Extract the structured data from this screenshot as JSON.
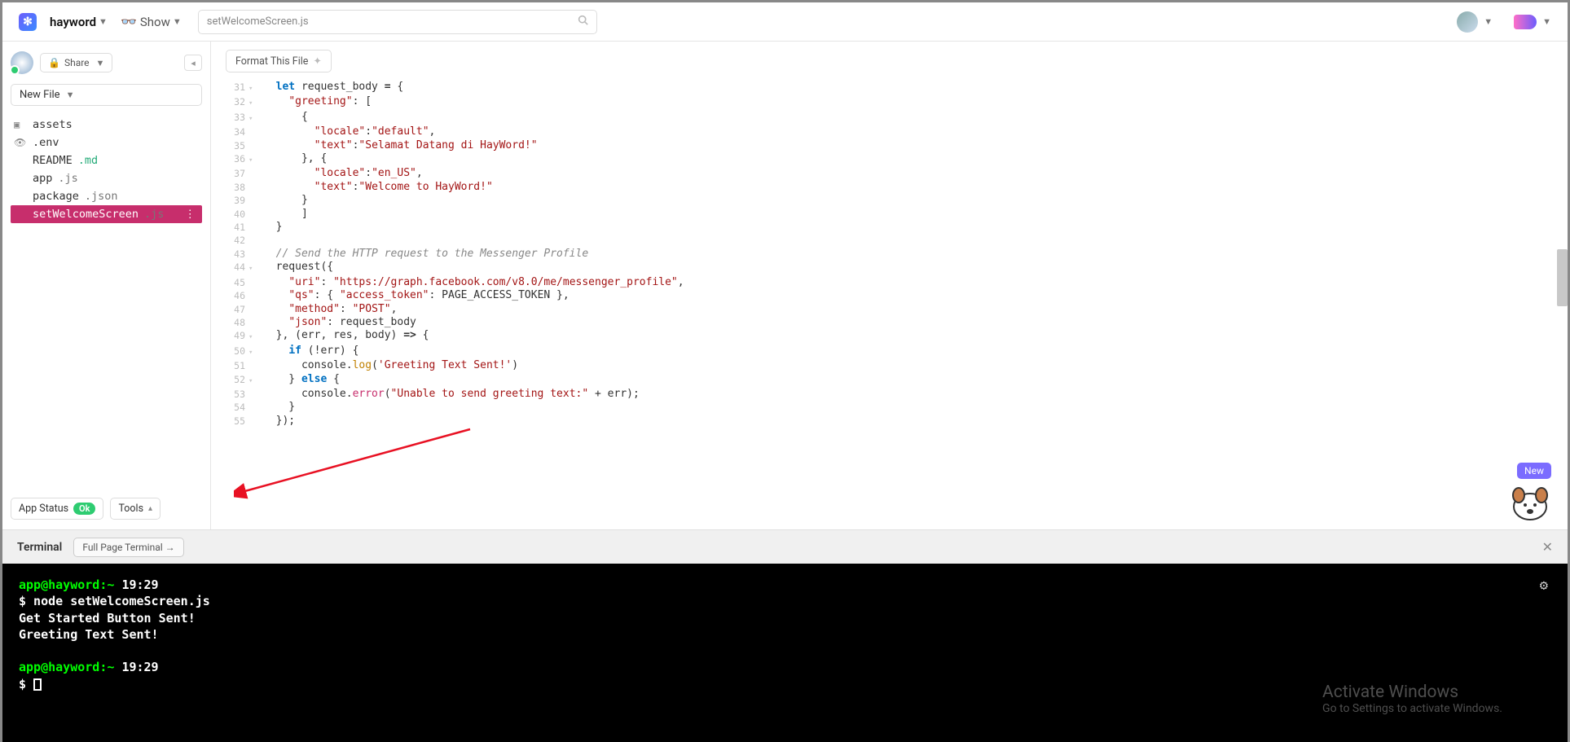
{
  "topbar": {
    "project": "hayword",
    "show_label": "Show",
    "search_value": "setWelcomeScreen.js"
  },
  "sidebar": {
    "share_label": "Share",
    "newfile_label": "New File",
    "files": [
      {
        "name": "assets",
        "icon": "folder"
      },
      {
        "name": ".env",
        "icon": "eye"
      },
      {
        "name": "README",
        "ext": ".md"
      },
      {
        "name": "app",
        "ext": ".js"
      },
      {
        "name": "package",
        "ext": ".json"
      },
      {
        "name": "setWelcomeScreen",
        "ext": ".js",
        "active": true
      }
    ],
    "app_status_label": "App Status",
    "app_status_value": "Ok",
    "tools_label": "Tools"
  },
  "editor": {
    "format_btn": "Format This File"
  },
  "code_lines": [
    {
      "n": 31,
      "f": "v",
      "html": "  <span class='kw'>let</span> request_body <span class='op'>=</span> {"
    },
    {
      "n": 32,
      "f": "v",
      "html": "    <span class='str'>\"greeting\"</span>: ["
    },
    {
      "n": 33,
      "f": "v",
      "html": "      {"
    },
    {
      "n": 34,
      "f": "",
      "html": "        <span class='str'>\"locale\"</span>:<span class='str'>\"default\"</span>,"
    },
    {
      "n": 35,
      "f": "",
      "html": "        <span class='str'>\"text\"</span>:<span class='str'>\"Selamat Datang di HayWord!\"</span>"
    },
    {
      "n": 36,
      "f": "v",
      "html": "      }, {"
    },
    {
      "n": 37,
      "f": "",
      "html": "        <span class='str'>\"locale\"</span>:<span class='str'>\"en_US\"</span>,"
    },
    {
      "n": 38,
      "f": "",
      "html": "        <span class='str'>\"text\"</span>:<span class='str'>\"Welcome to HayWord!\"</span>"
    },
    {
      "n": 39,
      "f": "",
      "html": "      }"
    },
    {
      "n": 40,
      "f": "",
      "html": "      ]"
    },
    {
      "n": 41,
      "f": "",
      "html": "  }"
    },
    {
      "n": 42,
      "f": "",
      "html": ""
    },
    {
      "n": 43,
      "f": "",
      "html": "  <span class='cm'>// Send the HTTP request to the Messenger Profile</span>"
    },
    {
      "n": 44,
      "f": "v",
      "html": "  request({"
    },
    {
      "n": 45,
      "f": "",
      "html": "    <span class='str'>\"uri\"</span>: <span class='str'>\"https://graph.facebook.com/v8.0/me/messenger_profile\"</span>,"
    },
    {
      "n": 46,
      "f": "",
      "html": "    <span class='str'>\"qs\"</span>: { <span class='str'>\"access_token\"</span>: PAGE_ACCESS_TOKEN },"
    },
    {
      "n": 47,
      "f": "",
      "html": "    <span class='str'>\"method\"</span>: <span class='str'>\"POST\"</span>,"
    },
    {
      "n": 48,
      "f": "",
      "html": "    <span class='str'>\"json\"</span>: request_body"
    },
    {
      "n": 49,
      "f": "v",
      "html": "  }, (err, res, body) <span class='op'>=&gt;</span> {"
    },
    {
      "n": 50,
      "f": "v",
      "html": "    <span class='kw'>if</span> (!err) {"
    },
    {
      "n": 51,
      "f": "",
      "html": "      console.<span class='fn'>log</span>(<span class='str'>'Greeting Text Sent!'</span>)"
    },
    {
      "n": 52,
      "f": "v",
      "html": "    } <span class='kw'>else</span> {"
    },
    {
      "n": 53,
      "f": "",
      "html": "      console.<span class='err'>error</span>(<span class='str'>\"Unable to send greeting text:\"</span> + err);"
    },
    {
      "n": 54,
      "f": "",
      "html": "    }"
    },
    {
      "n": 55,
      "f": "",
      "html": "  });"
    }
  ],
  "mascot": {
    "new_label": "New"
  },
  "terminal": {
    "title": "Terminal",
    "fullpage_label": "Full Page Terminal   →",
    "lines": [
      {
        "prompt": "app@hayword:~",
        "time": "19:29"
      },
      {
        "cmd": "$ node setWelcomeScreen.js"
      },
      {
        "out": "Get Started Button Sent!"
      },
      {
        "out": "Greeting Text Sent!"
      },
      {
        "blank": true
      },
      {
        "prompt": "app@hayword:~",
        "time": "19:29"
      },
      {
        "cursor": true
      }
    ]
  },
  "activate": {
    "title": "Activate Windows",
    "sub": "Go to Settings to activate Windows."
  }
}
